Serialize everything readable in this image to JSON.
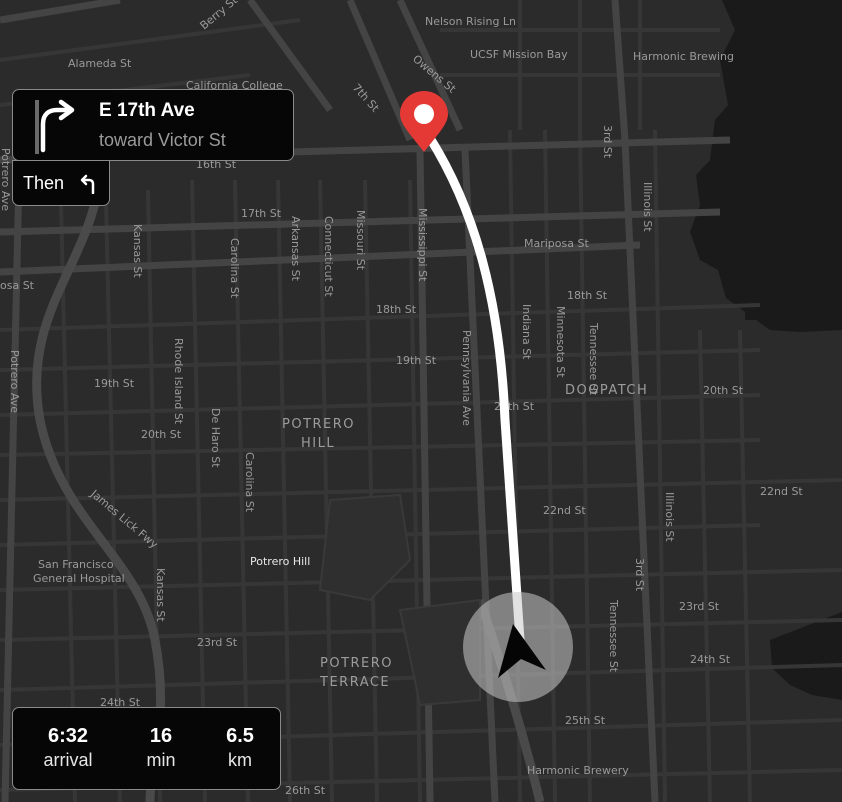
{
  "map": {
    "colors": {
      "land": "#2b2b2b",
      "water": "#1a1a1a",
      "road": "#3a3a3a",
      "major_road": "#454545",
      "route": "#ffffff",
      "pin": "#e53935",
      "puck_halo": "rgba(200,200,200,0.55)"
    },
    "streets": {
      "berry_st": "Berry St",
      "nelson_rising": "Nelson Rising Ln",
      "alameda": "Alameda St",
      "ucsf": "UCSF Mission Bay",
      "harmonic_brewing": "Harmonic Brewing",
      "california_college": "California College",
      "owens": "Owens St",
      "seventh": "7th St",
      "sixteenth": "16th St",
      "third_top": "3rd St",
      "illinois_top": "Illinois St",
      "potrero_ave_top": "Potrero Ave",
      "seventeenth": "17th St",
      "kansas_top": "Kansas St",
      "arkansas": "Arkansas St",
      "connecticut": "Connecticut St",
      "missouri": "Missouri St",
      "mississippi": "Mississippi St",
      "mariposa": "Mariposa St",
      "carolina_top": "Carolina St",
      "ssa": "osa St",
      "eighteenth_left": "18th St",
      "eighteenth_right": "18th St",
      "indiana": "Indiana St",
      "minnesota": "Minnesota St",
      "tennessee_top": "Tennessee St",
      "nineteenth_mid": "19th St",
      "nineteenth_left": "19th St",
      "potrero_ave": "Potrero Ave",
      "rhode_island": "Rhode Island St",
      "pennsylvania": "Pennsylvania Ave",
      "twentieth_right": "20th St",
      "twentieth_mid": "20th St",
      "twentieth_left": "20th St",
      "de_haro": "De Haro St",
      "carolina_mid": "Carolina St",
      "twentysecond_right": "22nd St",
      "twentysecond_mid": "22nd St",
      "illinois_mid": "Illinois St",
      "james_lick": "James Lick Fwy",
      "kansas_bottom": "Kansas St",
      "third_mid": "3rd St",
      "twentythird_right": "23rd St",
      "twentythird_left": "23rd St",
      "tennessee": "Tennessee St",
      "twentyfourth_right": "24th St",
      "twentyfourth_left": "24th St",
      "twentyfifth": "25th St",
      "harmonic_brewery": "Harmonic Brewery",
      "twentysixth": "26th St"
    },
    "areas": {
      "dogpatch": "DOGPATCH",
      "potrero_hill_1": "POTRERO",
      "potrero_hill_2": "HILL",
      "potrero_terrace_1": "POTRERO",
      "potrero_terrace_2": "TERRACE"
    },
    "poi": {
      "sf_general_1": "San Francisco",
      "sf_general_2": "General Hospital",
      "potrero_hill": "Potrero Hill"
    }
  },
  "navigation": {
    "maneuver_icon": "turn-right-arrow-icon",
    "street": "E 17th Ave",
    "toward": "toward Victor St",
    "then_label": "Then",
    "then_icon": "turn-left-arrow-icon"
  },
  "trip": {
    "arrival_value": "6:32",
    "arrival_unit": "arrival",
    "duration_value": "16",
    "duration_unit": "min",
    "distance_value": "6.5",
    "distance_unit": "km"
  }
}
